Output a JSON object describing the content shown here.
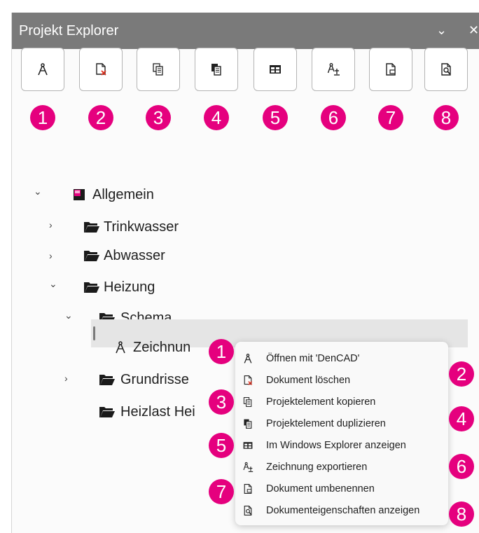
{
  "panel": {
    "title": "Projekt Explorer",
    "chevron_glyph": "⌄",
    "close_glyph": "✕"
  },
  "toolbar": {
    "buttons": [
      {
        "id": "1",
        "icon": "compass-icon"
      },
      {
        "id": "2",
        "icon": "document-delete-icon"
      },
      {
        "id": "3",
        "icon": "copy-icon"
      },
      {
        "id": "4",
        "icon": "duplicate-icon"
      },
      {
        "id": "5",
        "icon": "explorer-grid-icon"
      },
      {
        "id": "6",
        "icon": "export-drawing-icon"
      },
      {
        "id": "7",
        "icon": "rename-document-icon"
      },
      {
        "id": "8",
        "icon": "properties-icon"
      }
    ]
  },
  "badges": {
    "top": [
      "1",
      "2",
      "3",
      "4",
      "5",
      "6",
      "7",
      "8"
    ],
    "menu": [
      "1",
      "2",
      "3",
      "4",
      "5",
      "6",
      "7",
      "8"
    ]
  },
  "tree": {
    "root": "Allgemein",
    "trinkwasser": "Trinkwasser",
    "abwasser": "Abwasser",
    "heizung": "Heizung",
    "schema": "Schema",
    "zeichnung": "Zeichnun",
    "grundrisse": "Grundrisse",
    "heizlast": "Heizlast Hei"
  },
  "context_menu": {
    "items": [
      {
        "label": "Öffnen mit 'DenCAD'",
        "icon": "compass-icon"
      },
      {
        "label": "Dokument löschen",
        "icon": "document-delete-icon"
      },
      {
        "label": "Projektelement kopieren",
        "icon": "copy-icon"
      },
      {
        "label": "Projektelement duplizieren",
        "icon": "duplicate-icon"
      },
      {
        "label": "Im Windows Explorer anzeigen",
        "icon": "explorer-grid-icon"
      },
      {
        "label": "Zeichnung exportieren",
        "icon": "export-drawing-icon"
      },
      {
        "label": "Dokument umbenennen",
        "icon": "rename-document-icon"
      },
      {
        "label": "Dokumenteigenschaften anzeigen",
        "icon": "properties-icon"
      }
    ]
  },
  "colors": {
    "badge": "#e5007e",
    "titlebar": "#7a7a7a",
    "selection": "#e5e5e5",
    "root_icon": "#e5007e"
  }
}
